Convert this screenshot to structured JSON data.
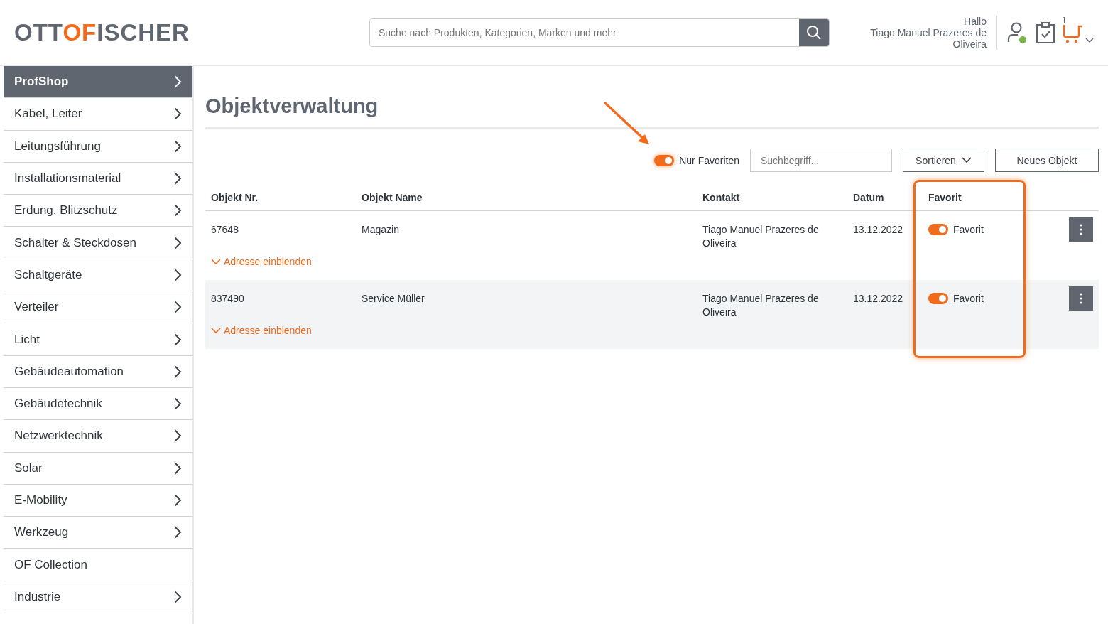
{
  "logo": {
    "before": "OTT",
    "mark": "OF",
    "after": "ISCHER"
  },
  "search": {
    "placeholder": "Suche nach Produkten, Kategorien, Marken und mehr"
  },
  "user": {
    "greeting": "Hallo",
    "name": "Tiago Manuel Prazeres de Oliveira",
    "online": true
  },
  "cart": {
    "count": "1"
  },
  "sidebar": {
    "items": [
      {
        "label": "ProfShop",
        "selected": true,
        "has_children": true
      },
      {
        "label": "Kabel, Leiter",
        "selected": false,
        "has_children": true
      },
      {
        "label": "Leitungsführung",
        "selected": false,
        "has_children": true
      },
      {
        "label": "Installationsmaterial",
        "selected": false,
        "has_children": true
      },
      {
        "label": "Erdung, Blitzschutz",
        "selected": false,
        "has_children": true
      },
      {
        "label": "Schalter & Steckdosen",
        "selected": false,
        "has_children": true
      },
      {
        "label": "Schaltgeräte",
        "selected": false,
        "has_children": true
      },
      {
        "label": "Verteiler",
        "selected": false,
        "has_children": true
      },
      {
        "label": "Licht",
        "selected": false,
        "has_children": true
      },
      {
        "label": "Gebäudeautomation",
        "selected": false,
        "has_children": true
      },
      {
        "label": "Gebäudetechnik",
        "selected": false,
        "has_children": true
      },
      {
        "label": "Netzwerktechnik",
        "selected": false,
        "has_children": true
      },
      {
        "label": "Solar",
        "selected": false,
        "has_children": true
      },
      {
        "label": "E-Mobility",
        "selected": false,
        "has_children": true
      },
      {
        "label": "Werkzeug",
        "selected": false,
        "has_children": true
      },
      {
        "label": "OF Collection",
        "selected": false,
        "has_children": false
      },
      {
        "label": "Industrie",
        "selected": false,
        "has_children": true
      }
    ]
  },
  "page_title": "Objektverwaltung",
  "toolbar": {
    "favorites_toggle": {
      "label": "Nur Favoriten",
      "on": true
    },
    "search": {
      "placeholder": "Suchbegriff..."
    },
    "sort_button": "Sortieren",
    "new_button": "Neues Objekt"
  },
  "table": {
    "columns": [
      "Objekt Nr.",
      "Objekt Name",
      "Kontakt",
      "Datum",
      "Favorit"
    ],
    "rows": [
      {
        "number": "67648",
        "name": "Magazin",
        "contact": "Tiago Manuel Prazeres de Oliveira",
        "date": "13.12.2022",
        "favorite": {
          "label": "Favorit",
          "on": true
        },
        "address_link": "Adresse einblenden"
      },
      {
        "number": "837490",
        "name": "Service Müller",
        "contact": "Tiago Manuel Prazeres de Oliveira",
        "date": "13.12.2022",
        "favorite": {
          "label": "Favorit",
          "on": true
        },
        "address_link": "Adresse einblenden"
      }
    ]
  }
}
